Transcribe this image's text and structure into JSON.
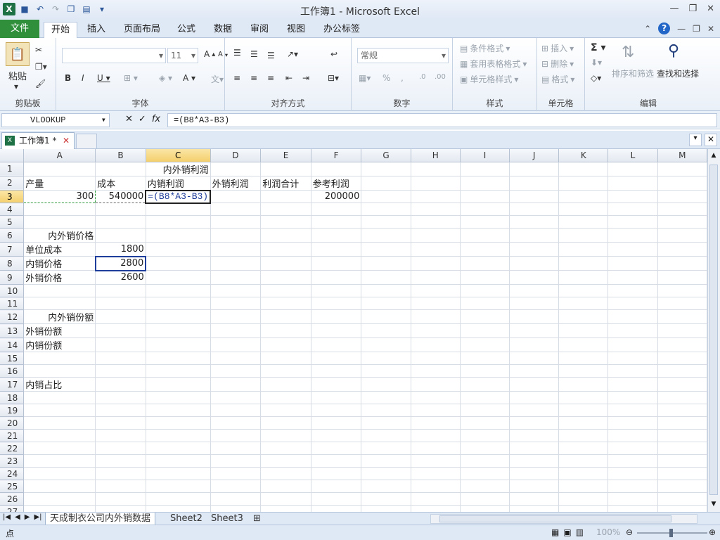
{
  "window": {
    "title": "工作簿1  -  Microsoft Excel"
  },
  "tabs": {
    "file": "文件",
    "home": "开始",
    "insert": "插入",
    "layout": "页面布局",
    "formulas": "公式",
    "data": "数据",
    "review": "审阅",
    "view": "视图",
    "office_tab": "办公标签"
  },
  "ribbon": {
    "clipboard": {
      "label": "剪贴板",
      "paste": "粘贴"
    },
    "font": {
      "label": "字体",
      "size": "11"
    },
    "alignment": {
      "label": "对齐方式"
    },
    "number": {
      "label": "数字",
      "format": "常规"
    },
    "styles": {
      "label": "样式",
      "conditional": "条件格式",
      "table": "套用表格格式",
      "cell": "单元格样式"
    },
    "cells": {
      "label": "单元格",
      "insert": "插入",
      "delete": "删除",
      "format": "格式"
    },
    "editing": {
      "label": "编辑",
      "sort": "排序和筛选",
      "find": "查找和选择"
    }
  },
  "formula_bar": {
    "name_box": "VLOOKUP",
    "formula": "=(B8*A3-B3)"
  },
  "document_tab": {
    "name": "工作簿1 *"
  },
  "columns": [
    "A",
    "B",
    "C",
    "D",
    "E",
    "F",
    "G",
    "H",
    "I",
    "J",
    "K",
    "L",
    "M"
  ],
  "rows": {
    "r1": {
      "A": "",
      "B": "",
      "C": "内外销利润",
      "D": "",
      "E": "",
      "F": ""
    },
    "r2": {
      "A": "产量",
      "B": "成本",
      "C": "内销利润",
      "D": "外销利润",
      "E": "利润合计",
      "F": "参考利润"
    },
    "r3": {
      "A": "300",
      "B": "540000",
      "C": "=(B8*A3-B3)",
      "D": "",
      "E": "",
      "F": "200000"
    },
    "r6": {
      "A": "内外销价格"
    },
    "r7": {
      "A": "单位成本",
      "B": "1800"
    },
    "r8": {
      "A": "内销价格",
      "B": "2800"
    },
    "r9": {
      "A": "外销价格",
      "B": "2600"
    },
    "r12": {
      "A": "内外销份额"
    },
    "r13": {
      "A": "外销份额"
    },
    "r14": {
      "A": "内销份额"
    },
    "r17": {
      "A": "内销占比"
    }
  },
  "sheets": [
    "天成制衣公司内外销数据",
    "Sheet2",
    "Sheet3"
  ],
  "status": {
    "mode": "点",
    "zoom": "100%"
  }
}
